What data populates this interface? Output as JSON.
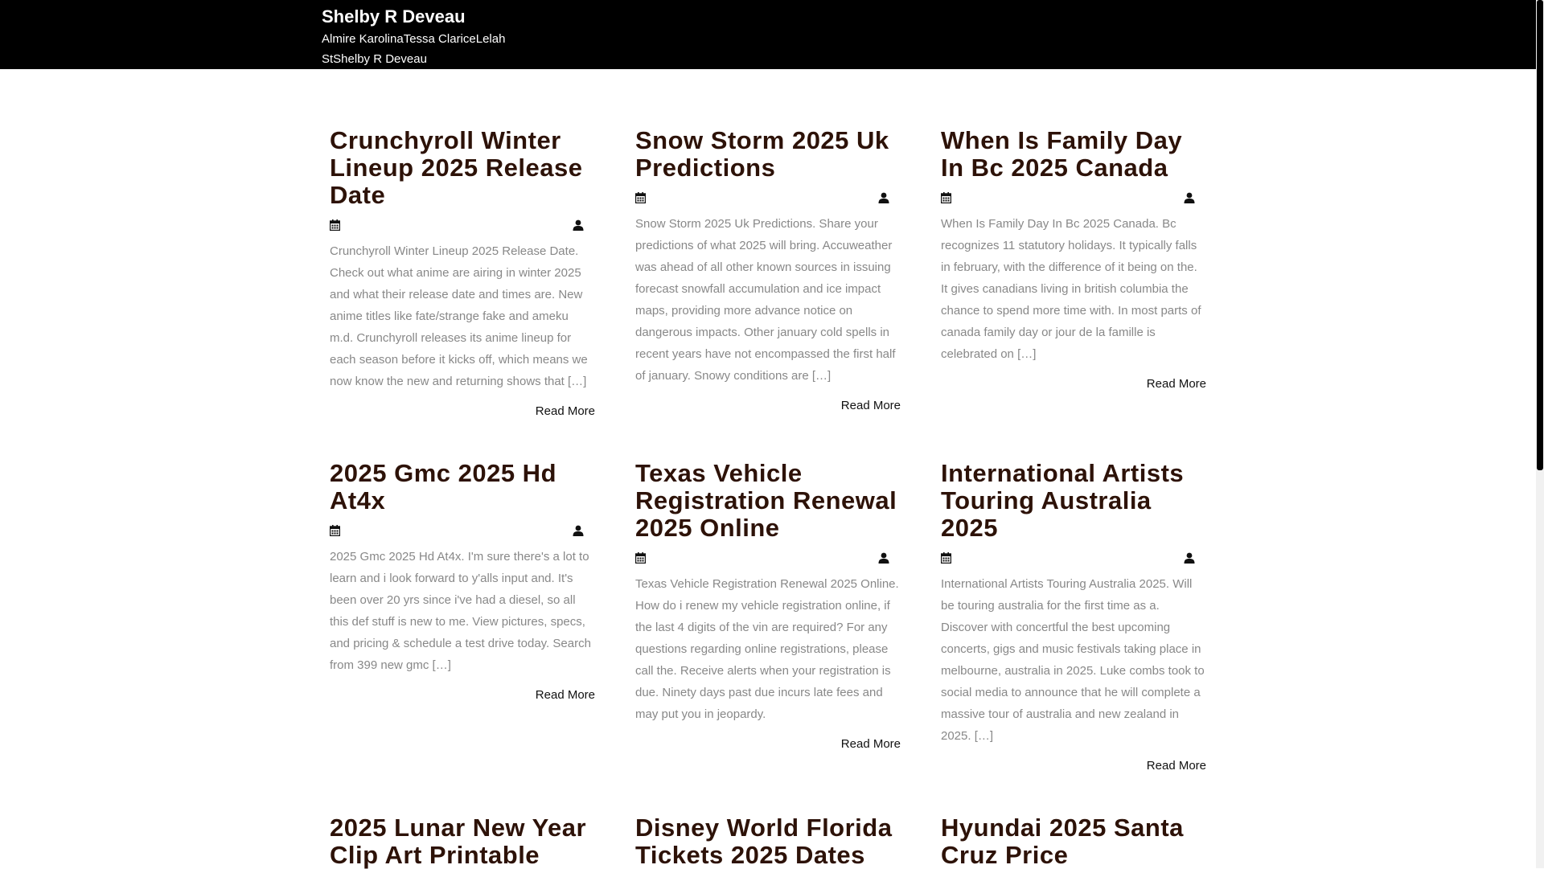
{
  "site": {
    "title": "Shelby R Deveau",
    "description": "Almire KarolinaTessa ClariceLelah StShelby R Deveau"
  },
  "icons": {
    "date": "calendar-icon",
    "author": "user-icon"
  },
  "colors": {
    "header_bg": "#000000",
    "title": "#2d1208",
    "excerpt": "#888888"
  },
  "posts": [
    {
      "title": "Crunchyroll Winter Lineup 2025 Release Date",
      "excerpt": "Crunchyroll Winter Lineup 2025 Release Date. Check out what anime are airing in winter 2025 and what their release date and times are. New anime titles like fate/strange fake and ameku m.d. Crunchyroll releases its anime lineup for each season before it kicks off, which means we now know the new and returning shows that […]",
      "read_more": "Read More"
    },
    {
      "title": "Snow Storm 2025 Uk Predictions",
      "excerpt": "Snow Storm 2025 Uk Predictions. Share your predictions of what 2025 will bring. Accuweather was ahead of all other known sources in issuing forecast snowfall accumulation and ice impact maps, providing more advance notice on dangerous impacts. Other january cold spells in recent years have not encompassed the first half of january. Snowy conditions are […]",
      "read_more": "Read More"
    },
    {
      "title": "When Is Family Day In Bc 2025 Canada",
      "excerpt": "When Is Family Day In Bc 2025 Canada. Bc recognizes 11 statutory holidays. It typically falls in february, with the difference of it being on the. It gives canadians living in british columbia the chance to spend more time with. In most parts of canada family day or jour de la famille is celebrated on […]",
      "read_more": "Read More"
    },
    {
      "title": "2025 Gmc 2025 Hd At4x",
      "excerpt": "2025 Gmc 2025 Hd At4x. I'm sure there's a lot to learn and i look forward to y'alls input and. It's been over 20 yrs since i've had a diesel, so all this def stuff is new to me. View pictures, specs, and pricing & schedule a test drive today. Search from 399 new gmc […]",
      "read_more": "Read More"
    },
    {
      "title": "Texas Vehicle Registration Renewal 2025 Online",
      "excerpt": "Texas Vehicle Registration Renewal 2025 Online. How do i renew my vehicle registration online, if the last 4 digits of the vin are required? For any questions regarding online registrations, please call the. Receive alerts when your registration is due. Ninety days past due incurs late fees and may put you in jeopardy.",
      "read_more": "Read More"
    },
    {
      "title": "International Artists Touring Australia 2025",
      "excerpt": "International Artists Touring Australia 2025. Will be touring australia for the first time as a. Discover with concertful the best upcoming concerts, gigs and music festivals taking place in melbourne, australia in 2025. Luke combs took to social media to announce that he will complete a massive tour of australia and new zealand in 2025. […]",
      "read_more": "Read More"
    },
    {
      "title": "2025 Lunar New Year Clip Art Printable"
    },
    {
      "title": "Disney World Florida Tickets 2025 Dates"
    },
    {
      "title": "Hyundai 2025 Santa Cruz Price"
    }
  ]
}
